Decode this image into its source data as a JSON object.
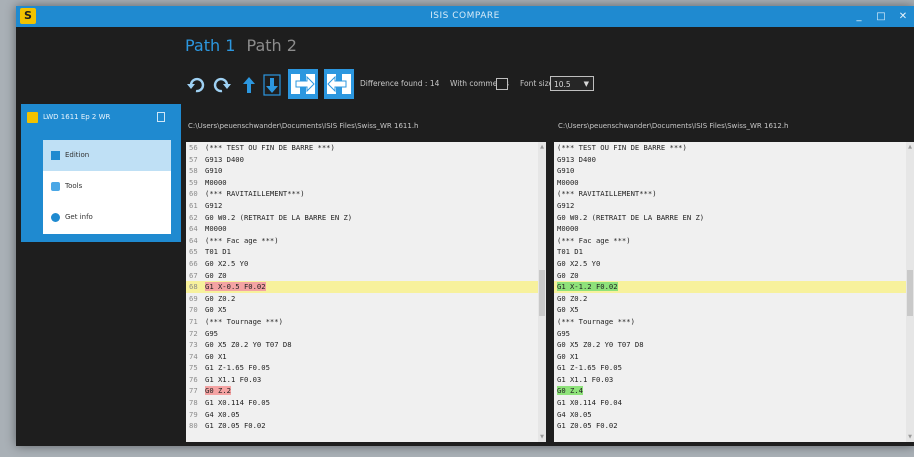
{
  "window": {
    "title": "ISIS COMPARE",
    "app_icon_glyph": "S",
    "min_glyph": "_",
    "max_glyph": "□",
    "close_glyph": "✕"
  },
  "colors": {
    "accent": "#1f8ad0",
    "tab_active": "#2c97df",
    "diff_line": "#f7f19c",
    "diff_left": "#f4a3a3",
    "diff_right": "#8ee27a"
  },
  "tabs": [
    "Path 1",
    "Path 2"
  ],
  "toolbar": {
    "icons": [
      "undo-icon",
      "redo-icon",
      "arrow-up-icon",
      "arrow-down-icon",
      "copy-right-icon",
      "copy-left-icon"
    ],
    "differences_label": "Difference found : 14",
    "with_comments_label": "With comments",
    "with_comments_checked": false,
    "font_size_label": "Font size :",
    "font_size_value": "10.5"
  },
  "sidebar": {
    "header": "LWD 1611 Ep 2 WR",
    "items": [
      {
        "label": "Edition",
        "icon": "edit-icon"
      },
      {
        "label": "Tools",
        "icon": "tools-icon"
      },
      {
        "label": "Get info",
        "icon": "info-icon"
      }
    ]
  },
  "left_pane": {
    "path": "C:\\Users\\peuenschwander\\Documents\\ISIS Files\\Swiss_WR 1611.h",
    "lines": [
      {
        "n": "56",
        "t": "(*** TEST OU FIN DE BARRE ***)",
        "hl": "",
        "mark": ""
      },
      {
        "n": "57",
        "t": "G913 D400",
        "hl": "",
        "mark": ""
      },
      {
        "n": "58",
        "t": "G910",
        "hl": "",
        "mark": ""
      },
      {
        "n": "59",
        "t": "M0000",
        "hl": "",
        "mark": ""
      },
      {
        "n": "60",
        "t": "(*** RAVITAILLEMENT***)",
        "hl": "",
        "mark": ""
      },
      {
        "n": "61",
        "t": "G912",
        "hl": "",
        "mark": ""
      },
      {
        "n": "62",
        "t": "G0 W0.2 (RETRAIT DE LA BARRE EN Z)",
        "hl": "",
        "mark": ""
      },
      {
        "n": "64",
        "t": "M0000",
        "hl": "",
        "mark": ""
      },
      {
        "n": "64",
        "t": "(*** Fac age ***)",
        "hl": "",
        "mark": ""
      },
      {
        "n": "65",
        "t": "T01 D1",
        "hl": "",
        "mark": ""
      },
      {
        "n": "66",
        "t": "G0 X2.5 Y0",
        "hl": "",
        "mark": ""
      },
      {
        "n": "67",
        "t": "G0 Z0",
        "hl": "",
        "mark": ""
      },
      {
        "n": "68",
        "t": "G1 X-0.5 F0.02",
        "hl": "yellow",
        "mark": "red"
      },
      {
        "n": "69",
        "t": "G0 Z0.2",
        "hl": "",
        "mark": ""
      },
      {
        "n": "70",
        "t": "G0 X5",
        "hl": "",
        "mark": ""
      },
      {
        "n": "71",
        "t": "(*** Tournage ***)",
        "hl": "",
        "mark": ""
      },
      {
        "n": "72",
        "t": "G95",
        "hl": "",
        "mark": ""
      },
      {
        "n": "73",
        "t": "G0 X5 Z0.2 Y0 T07 D8",
        "hl": "",
        "mark": ""
      },
      {
        "n": "74",
        "t": "G0 X1",
        "hl": "",
        "mark": ""
      },
      {
        "n": "75",
        "t": "G1 Z-1.65 F0.05",
        "hl": "",
        "mark": ""
      },
      {
        "n": "76",
        "t": "G1 X1.1 F0.03",
        "hl": "",
        "mark": ""
      },
      {
        "n": "77",
        "t": "G0 Z.2",
        "hl": "",
        "mark": "red"
      },
      {
        "n": "78",
        "t": "G1 X0.114 F0.05",
        "hl": "",
        "mark": ""
      },
      {
        "n": "79",
        "t": "G4 X0.05",
        "hl": "",
        "mark": ""
      },
      {
        "n": "80",
        "t": "G1 Z0.05 F0.02",
        "hl": "",
        "mark": ""
      }
    ]
  },
  "right_pane": {
    "path": "C:\\Users\\peuenschwander\\Documents\\ISIS Files\\Swiss_WR 1612.h",
    "lines": [
      {
        "t": "(*** TEST OU FIN DE BARRE ***)",
        "hl": "",
        "mark": ""
      },
      {
        "t": "G913 D400",
        "hl": "",
        "mark": ""
      },
      {
        "t": "G910",
        "hl": "",
        "mark": ""
      },
      {
        "t": "M0000",
        "hl": "",
        "mark": ""
      },
      {
        "t": "(*** RAVITAILLEMENT***)",
        "hl": "",
        "mark": ""
      },
      {
        "t": "G912",
        "hl": "",
        "mark": ""
      },
      {
        "t": "G0 W0.2 (RETRAIT DE LA BARRE EN Z)",
        "hl": "",
        "mark": ""
      },
      {
        "t": "M0000",
        "hl": "",
        "mark": ""
      },
      {
        "t": "(*** Fac age ***)",
        "hl": "",
        "mark": ""
      },
      {
        "t": "T01 D1",
        "hl": "",
        "mark": ""
      },
      {
        "t": "G0 X2.5 Y0",
        "hl": "",
        "mark": ""
      },
      {
        "t": "G0 Z0",
        "hl": "",
        "mark": ""
      },
      {
        "t": "G1 X-1.2 F0.02",
        "hl": "yellow",
        "mark": "green"
      },
      {
        "t": "G0 Z0.2",
        "hl": "",
        "mark": ""
      },
      {
        "t": "G0 X5",
        "hl": "",
        "mark": ""
      },
      {
        "t": "(*** Tournage ***)",
        "hl": "",
        "mark": ""
      },
      {
        "t": "G95",
        "hl": "",
        "mark": ""
      },
      {
        "t": "G0 X5 Z0.2 Y0 T07 D8",
        "hl": "",
        "mark": ""
      },
      {
        "t": "G0 X1",
        "hl": "",
        "mark": ""
      },
      {
        "t": "G1 Z-1.65 F0.05",
        "hl": "",
        "mark": ""
      },
      {
        "t": "G1 X1.1 F0.03",
        "hl": "",
        "mark": ""
      },
      {
        "t": "G0 Z.4",
        "hl": "",
        "mark": "green"
      },
      {
        "t": "G1 X0.114 F0.04",
        "hl": "",
        "mark": ""
      },
      {
        "t": "G4 X0.05",
        "hl": "",
        "mark": ""
      },
      {
        "t": "G1 Z0.05 F0.02",
        "hl": "",
        "mark": ""
      }
    ]
  }
}
